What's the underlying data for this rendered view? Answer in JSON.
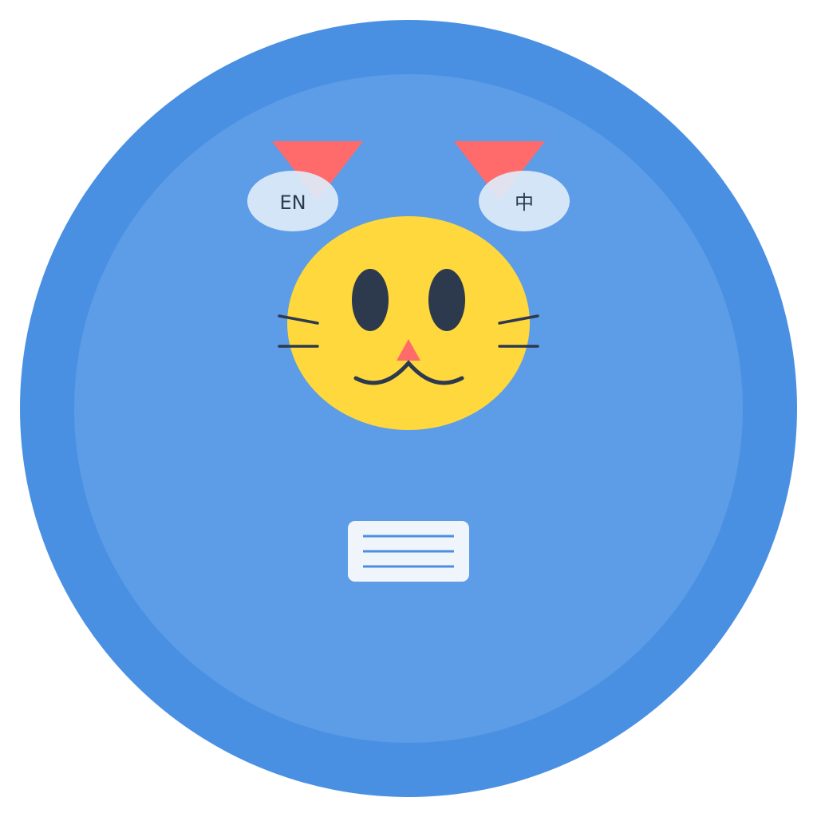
{
  "logo": {
    "icon": "translator-cat-logo",
    "colors": {
      "outer_ring": "#4a90e2",
      "inner_disc": "#5d9ce6",
      "cat_face": "#fed83d",
      "ears": "#ff6b6b",
      "eyes": "#2d3a4d",
      "nose": "#ff6b6b",
      "bubble": "#e0ebfa",
      "card": "#f0f5fc",
      "card_lines": "#4a90e2"
    },
    "language_left": "EN",
    "language_right": "中",
    "text_card_icon": "text-document-icon"
  }
}
